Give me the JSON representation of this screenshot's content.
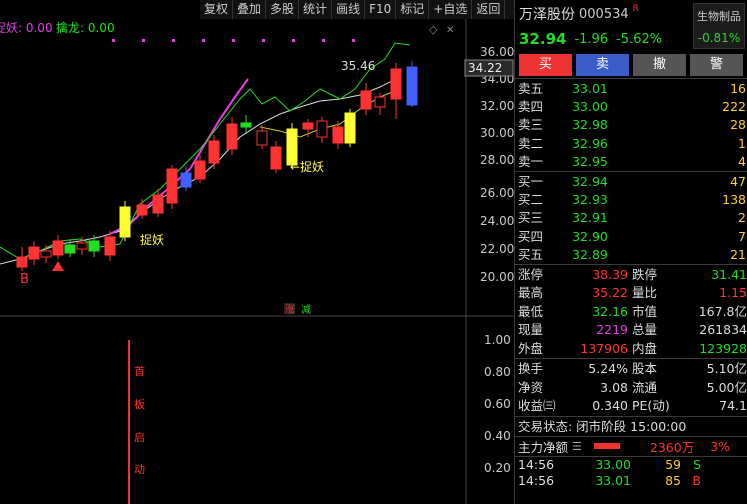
{
  "toolbar": [
    "复权",
    "叠加",
    "多股",
    "统计",
    "画线",
    "F10",
    "标记",
    "+自选",
    "返回"
  ],
  "indicator": {
    "label1": "捉妖: 0.00",
    "label2": "擒龙: 0.00"
  },
  "price_axis": [
    "36.00",
    "34.00",
    "32.00",
    "30.00",
    "28.00",
    "26.00",
    "24.00",
    "22.00",
    "20.00"
  ],
  "current_price_tag": "34.22",
  "high_label": "35.46",
  "chart_labels": {
    "catch_demon": "捉妖",
    "catch_demon_arrow": "←捉妖",
    "b_marker": "B",
    "zhang": "涨",
    "jian": "减"
  },
  "sub_axis": [
    "1.00",
    "0.80",
    "0.60",
    "0.40",
    "0.20"
  ],
  "vertical_text": [
    "首",
    "板",
    "启",
    "动"
  ],
  "stock": {
    "name": "万泽股份",
    "code": "000534",
    "r": "R",
    "sector": "生物制品",
    "sector_pct": "-0.81%",
    "price": "32.94",
    "change": "-1.96",
    "change_pct": "-5.62%"
  },
  "buttons": [
    "买",
    "卖",
    "撤",
    "警"
  ],
  "asks": [
    {
      "label": "卖五",
      "price": "33.01",
      "vol": "16"
    },
    {
      "label": "卖四",
      "price": "33.00",
      "vol": "222"
    },
    {
      "label": "卖三",
      "price": "32.98",
      "vol": "28"
    },
    {
      "label": "卖二",
      "price": "32.96",
      "vol": "1"
    },
    {
      "label": "卖一",
      "price": "32.95",
      "vol": "4"
    }
  ],
  "bids": [
    {
      "label": "买一",
      "price": "32.94",
      "vol": "47"
    },
    {
      "label": "买二",
      "price": "32.93",
      "vol": "138"
    },
    {
      "label": "买三",
      "price": "32.91",
      "vol": "2"
    },
    {
      "label": "买四",
      "price": "32.90",
      "vol": "7"
    },
    {
      "label": "买五",
      "price": "32.89",
      "vol": "21"
    }
  ],
  "stats1": [
    {
      "k": "涨停",
      "v": "38.39",
      "k2": "跌停",
      "v2": "31.41"
    },
    {
      "k": "最高",
      "v": "35.22",
      "k2": "量比",
      "v2": "1.15"
    },
    {
      "k": "最低",
      "v": "32.16",
      "k2": "市值",
      "v2": "167.8亿"
    },
    {
      "k": "现量",
      "v": "2219",
      "k2": "总量",
      "v2": "261834"
    },
    {
      "k": "外盘",
      "v": "137906",
      "k2": "内盘",
      "v2": "123928"
    }
  ],
  "stats2": [
    {
      "k": "换手",
      "v": "5.24%",
      "k2": "股本",
      "v2": "5.10亿"
    },
    {
      "k": "净资",
      "v": "3.08",
      "k2": "流通",
      "v2": "5.00亿"
    },
    {
      "k": "收益㈢",
      "v": "0.340",
      "k2": "PE(动)",
      "v2": "74.1"
    }
  ],
  "status": "交易状态: 闭市阶段 15:00:00",
  "flow": {
    "label": "主力净额",
    "value": "2360万",
    "pct": "3%"
  },
  "ticks": [
    {
      "time": "14:56",
      "price": "33.00",
      "vol": "59",
      "side": "S"
    },
    {
      "time": "14:56",
      "price": "33.01",
      "vol": "85",
      "side": "B"
    }
  ]
}
